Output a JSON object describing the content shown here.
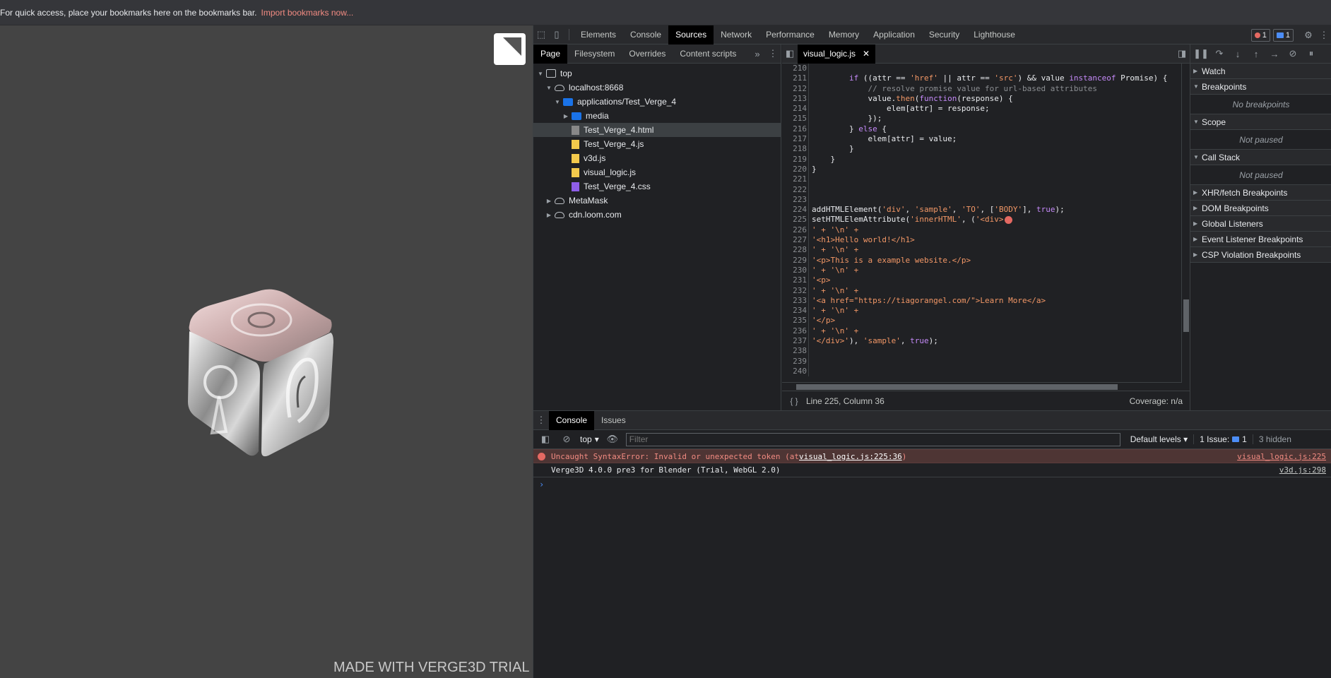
{
  "bookmarks_bar": {
    "message": "For quick access, place your bookmarks here on the bookmarks bar.",
    "import_link": "Import bookmarks now..."
  },
  "viewport": {
    "watermark": "MADE WITH VERGE3D TRIAL"
  },
  "devtools": {
    "main_tabs": [
      "Elements",
      "Console",
      "Sources",
      "Network",
      "Performance",
      "Memory",
      "Application",
      "Security",
      "Lighthouse"
    ],
    "active_tab": "Sources",
    "error_count": "1",
    "message_count": "1",
    "navigator": {
      "tabs": [
        "Page",
        "Filesystem",
        "Overrides",
        "Content scripts"
      ],
      "tree": [
        {
          "label": "top"
        },
        {
          "label": "localhost:8668"
        },
        {
          "label": "applications/Test_Verge_4"
        },
        {
          "label": "media"
        },
        {
          "label": "Test_Verge_4.html"
        },
        {
          "label": "Test_Verge_4.js"
        },
        {
          "label": "v3d.js"
        },
        {
          "label": "visual_logic.js"
        },
        {
          "label": "Test_Verge_4.css"
        },
        {
          "label": "MetaMask"
        },
        {
          "label": "cdn.loom.com"
        }
      ]
    },
    "editor": {
      "open_file": "visual_logic.js",
      "line_numbers": [
        "210",
        "211",
        "212",
        "213",
        "214",
        "215",
        "216",
        "217",
        "218",
        "219",
        "220",
        "221",
        "222",
        "223",
        "224",
        "225",
        "226",
        "227",
        "228",
        "229",
        "230",
        "231",
        "232",
        "233",
        "234",
        "235",
        "236",
        "237",
        "238",
        "239",
        "240"
      ],
      "status": "Line 225, Column 36",
      "coverage": "Coverage: n/a"
    },
    "debugger": {
      "panes": [
        {
          "title": "Watch"
        },
        {
          "title": "Breakpoints",
          "body": "No breakpoints"
        },
        {
          "title": "Scope",
          "body": "Not paused"
        },
        {
          "title": "Call Stack",
          "body": "Not paused"
        },
        {
          "title": "XHR/fetch Breakpoints"
        },
        {
          "title": "DOM Breakpoints"
        },
        {
          "title": "Global Listeners"
        },
        {
          "title": "Event Listener Breakpoints"
        },
        {
          "title": "CSP Violation Breakpoints"
        }
      ]
    },
    "console": {
      "tabs": [
        "Console",
        "Issues"
      ],
      "context": "top",
      "filter_placeholder": "Filter",
      "levels": "Default levels",
      "issues_badge": "1 Issue:",
      "issues_count": "1",
      "hidden": "3 hidden",
      "messages": [
        {
          "text_before": "Uncaught SyntaxError: Invalid or unexpected token (at ",
          "link": "visual_logic.js:225:36",
          "text_after": ")",
          "source": "visual_logic.js:225"
        },
        {
          "text": "Verge3D 4.0.0 pre3 for Blender (Trial, WebGL 2.0)",
          "source": "v3d.js:298"
        }
      ]
    }
  },
  "colors": {
    "accent_link": "#f28b82",
    "error_bg": "#4e3534",
    "keyword": "#c58af9",
    "string": "#f29766",
    "viewport_bg": "#444444"
  }
}
